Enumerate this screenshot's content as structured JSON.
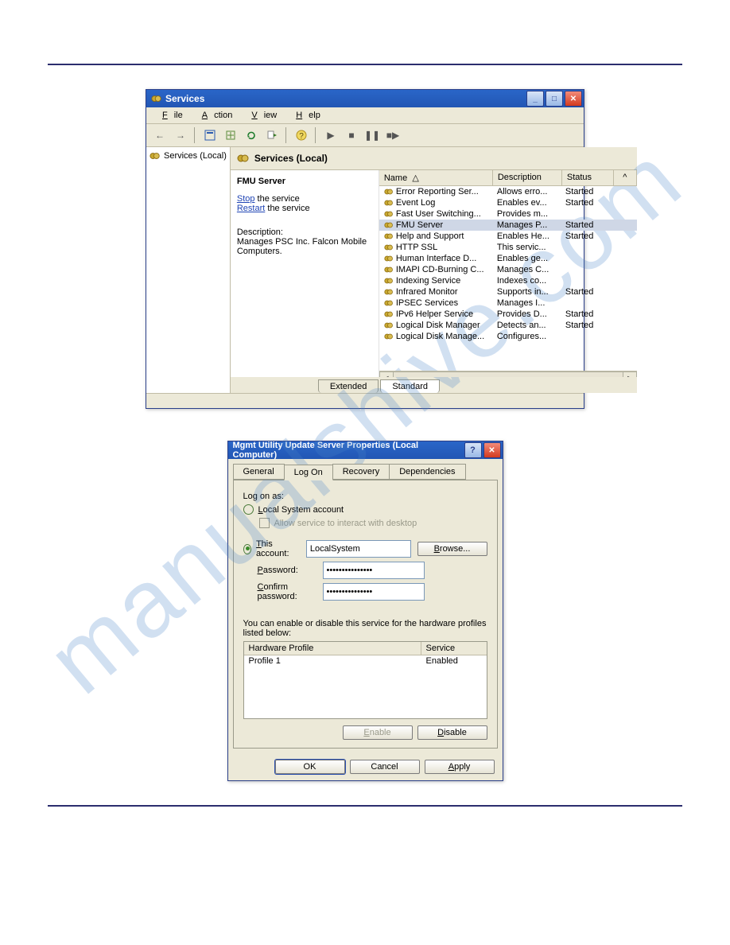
{
  "services_window": {
    "title": "Services",
    "menu": {
      "file": "File",
      "action": "Action",
      "view": "View",
      "help": "Help"
    },
    "tree": {
      "root": "Services (Local)"
    },
    "right_header": "Services (Local)",
    "detail": {
      "selected_name": "FMU Server",
      "stop_prefix": "Stop",
      "stop_suffix": " the service",
      "restart_prefix": "Restart",
      "restart_suffix": " the service",
      "desc_label": "Description:",
      "desc_text": "Manages PSC Inc. Falcon Mobile Computers."
    },
    "columns": {
      "name": "Name",
      "desc": "Description",
      "status": "Status"
    },
    "rows": [
      {
        "name": "Error Reporting Ser...",
        "desc": "Allows erro...",
        "status": "Started"
      },
      {
        "name": "Event Log",
        "desc": "Enables ev...",
        "status": "Started"
      },
      {
        "name": "Fast User Switching...",
        "desc": "Provides m...",
        "status": ""
      },
      {
        "name": "FMU Server",
        "desc": "Manages P...",
        "status": "Started",
        "selected": true
      },
      {
        "name": "Help and Support",
        "desc": "Enables He...",
        "status": "Started"
      },
      {
        "name": "HTTP SSL",
        "desc": "This servic...",
        "status": ""
      },
      {
        "name": "Human Interface D...",
        "desc": "Enables ge...",
        "status": ""
      },
      {
        "name": "IMAPI CD-Burning C...",
        "desc": "Manages C...",
        "status": ""
      },
      {
        "name": "Indexing Service",
        "desc": "Indexes co...",
        "status": ""
      },
      {
        "name": "Infrared Monitor",
        "desc": "Supports in...",
        "status": "Started"
      },
      {
        "name": "IPSEC Services",
        "desc": "Manages I...",
        "status": ""
      },
      {
        "name": "IPv6 Helper Service",
        "desc": "Provides D...",
        "status": "Started"
      },
      {
        "name": "Logical Disk Manager",
        "desc": "Detects an...",
        "status": "Started"
      },
      {
        "name": "Logical Disk Manage...",
        "desc": "Configures...",
        "status": ""
      }
    ],
    "bottom_tabs": {
      "extended": "Extended",
      "standard": "Standard"
    }
  },
  "properties_dialog": {
    "title": "Mgmt Utility Update Server Properties (Local Computer)",
    "tabs": {
      "general": "General",
      "logon": "Log On",
      "recovery": "Recovery",
      "dependencies": "Dependencies"
    },
    "logon_as": "Log on as:",
    "local_system": "Local System account",
    "allow_interact": "Allow service to interact with desktop",
    "this_account": "This account:",
    "account_value": "LocalSystem",
    "browse": "Browse...",
    "password": "Password:",
    "password_value": "•••••••••••••••",
    "confirm": "Confirm password:",
    "confirm_value": "•••••••••••••••",
    "hw_text": "You can enable or disable this service for the hardware profiles listed below:",
    "hw_cols": {
      "profile": "Hardware Profile",
      "service": "Service"
    },
    "hw_rows": [
      {
        "profile": "Profile 1",
        "service": "Enabled"
      }
    ],
    "enable": "Enable",
    "disable": "Disable",
    "ok": "OK",
    "cancel": "Cancel",
    "apply": "Apply"
  },
  "watermark": "manualshive.com"
}
